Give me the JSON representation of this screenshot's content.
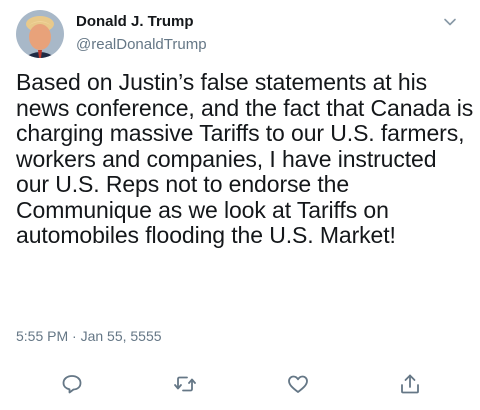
{
  "tweet": {
    "author_name": "Donald J. Trump",
    "author_handle": "@realDonaldTrump",
    "text": "Based on Justin’s false statements at his news conference, and the fact that Canada is charging massive Tariffs to our U.S. farmers, workers and companies, I have instructed our U.S. Reps not to endorse the Communique as we look at Tariffs on automobiles flooding the U.S. Market!",
    "timestamp": "5:55 PM · Jan 55, 5555"
  },
  "icons": {
    "menu": "chevron-down-icon",
    "reply": "reply-icon",
    "retweet": "retweet-icon",
    "like": "heart-icon",
    "share": "share-icon"
  },
  "colors": {
    "text_primary": "#14171a",
    "text_secondary": "#657786",
    "icon_gray": "#657786"
  }
}
